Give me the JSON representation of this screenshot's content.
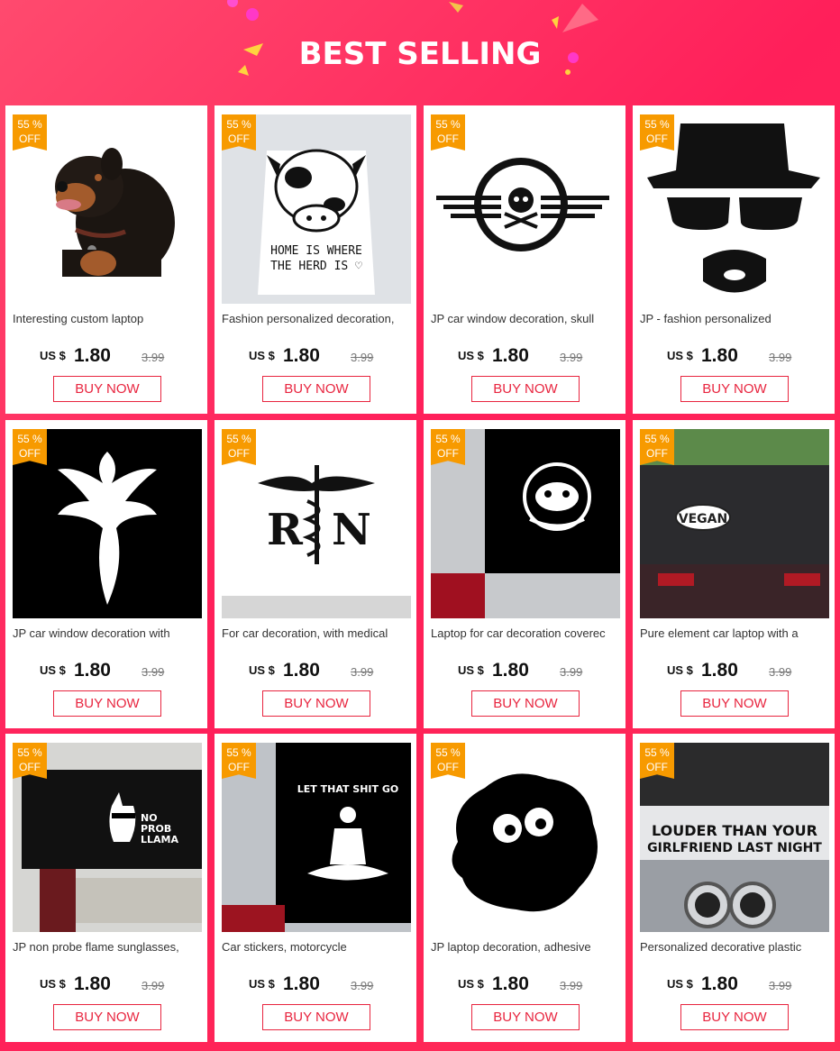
{
  "header": {
    "title": "BEST SELLING"
  },
  "colors": {
    "badge": "#f79a00",
    "accent": "#e8253f",
    "background": "#ff2d55"
  },
  "products": [
    {
      "badge_pct": "55 %",
      "badge_off": "OFF",
      "title": "Interesting custom laptop",
      "currency": "US $",
      "price": "1.80",
      "old_price": "3.99",
      "button": "BUY NOW",
      "image": "rottweiler-dog"
    },
    {
      "badge_pct": "55 %",
      "badge_off": "OFF",
      "title": "Fashion personalized decoration,",
      "currency": "US $",
      "price": "1.80",
      "old_price": "3.99",
      "button": "BUY NOW",
      "image": "cow-sticker",
      "image_text": [
        "HOME IS WHERE",
        "THE HERD IS"
      ]
    },
    {
      "badge_pct": "55 %",
      "badge_off": "OFF",
      "title": "JP car window decoration, skull",
      "currency": "US $",
      "price": "1.80",
      "old_price": "3.99",
      "button": "BUY NOW",
      "image": "skull-wings"
    },
    {
      "badge_pct": "55 %",
      "badge_off": "OFF",
      "title": "JP - fashion personalized",
      "currency": "US $",
      "price": "1.80",
      "old_price": "3.99",
      "button": "BUY NOW",
      "image": "hat-glasses-beard"
    },
    {
      "badge_pct": "55 %",
      "badge_off": "OFF",
      "title": "JP car window decoration with",
      "currency": "US $",
      "price": "1.80",
      "old_price": "3.99",
      "button": "BUY NOW",
      "image": "phoenix"
    },
    {
      "badge_pct": "55 %",
      "badge_off": "OFF",
      "title": "For car decoration, with medical",
      "currency": "US $",
      "price": "1.80",
      "old_price": "3.99",
      "button": "BUY NOW",
      "image": "rn-caduceus",
      "image_text": [
        "R",
        "N"
      ]
    },
    {
      "badge_pct": "55 %",
      "badge_off": "OFF",
      "title": "Laptop for car decoration coverec",
      "currency": "US $",
      "price": "1.80",
      "old_price": "3.99",
      "button": "BUY NOW",
      "image": "sloth-car"
    },
    {
      "badge_pct": "55 %",
      "badge_off": "OFF",
      "title": "Pure element car laptop with a",
      "currency": "US $",
      "price": "1.80",
      "old_price": "3.99",
      "button": "BUY NOW",
      "image": "vegan-car",
      "image_text": [
        "VEGAN"
      ]
    },
    {
      "badge_pct": "55 %",
      "badge_off": "OFF",
      "title": "JP non probe flame sunglasses,",
      "currency": "US $",
      "price": "1.80",
      "old_price": "3.99",
      "button": "BUY NOW",
      "image": "llama-car",
      "image_text": [
        "NO",
        "PROB",
        "LLAMA"
      ]
    },
    {
      "badge_pct": "55 %",
      "badge_off": "OFF",
      "title": "Car stickers, motorcycle",
      "currency": "US $",
      "price": "1.80",
      "old_price": "3.99",
      "button": "BUY NOW",
      "image": "buddha-car",
      "image_text": [
        "LET THAT SHIT GO"
      ]
    },
    {
      "badge_pct": "55 %",
      "badge_off": "OFF",
      "title": "JP laptop decoration, adhesive",
      "currency": "US $",
      "price": "1.80",
      "old_price": "3.99",
      "button": "BUY NOW",
      "image": "soot-sprite"
    },
    {
      "badge_pct": "55 %",
      "badge_off": "OFF",
      "title": "Personalized decorative plastic",
      "currency": "US $",
      "price": "1.80",
      "old_price": "3.99",
      "button": "BUY NOW",
      "image": "louder-exhaust",
      "image_text": [
        "LOUDER THAN YOUR",
        "GIRLFRIEND LAST NIGHT"
      ]
    }
  ]
}
